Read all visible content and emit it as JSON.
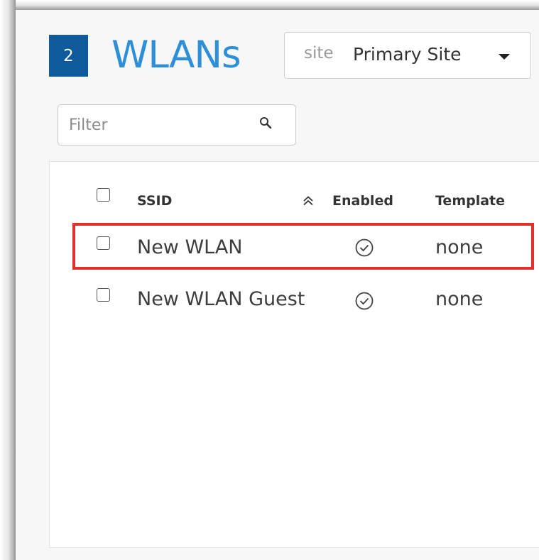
{
  "header": {
    "count": "2",
    "title": "WLANs",
    "site_prefix": "site",
    "site_value": "Primary Site"
  },
  "filter": {
    "placeholder": "Filter"
  },
  "table": {
    "columns": {
      "ssid": "SSID",
      "enabled": "Enabled",
      "template": "Template"
    },
    "rows": [
      {
        "ssid": "New WLAN",
        "enabled": true,
        "template": "none"
      },
      {
        "ssid": "New WLAN Guest",
        "enabled": true,
        "template": "none"
      }
    ]
  },
  "colors": {
    "badge": "#0f5a9c",
    "title": "#2e8fd9",
    "highlight": "#e0302c"
  },
  "icons": {
    "filter": "search-icon",
    "sort": "double-chevron-up-icon",
    "enabled": "check-circle-icon",
    "site_dropdown": "caret-down-icon"
  }
}
